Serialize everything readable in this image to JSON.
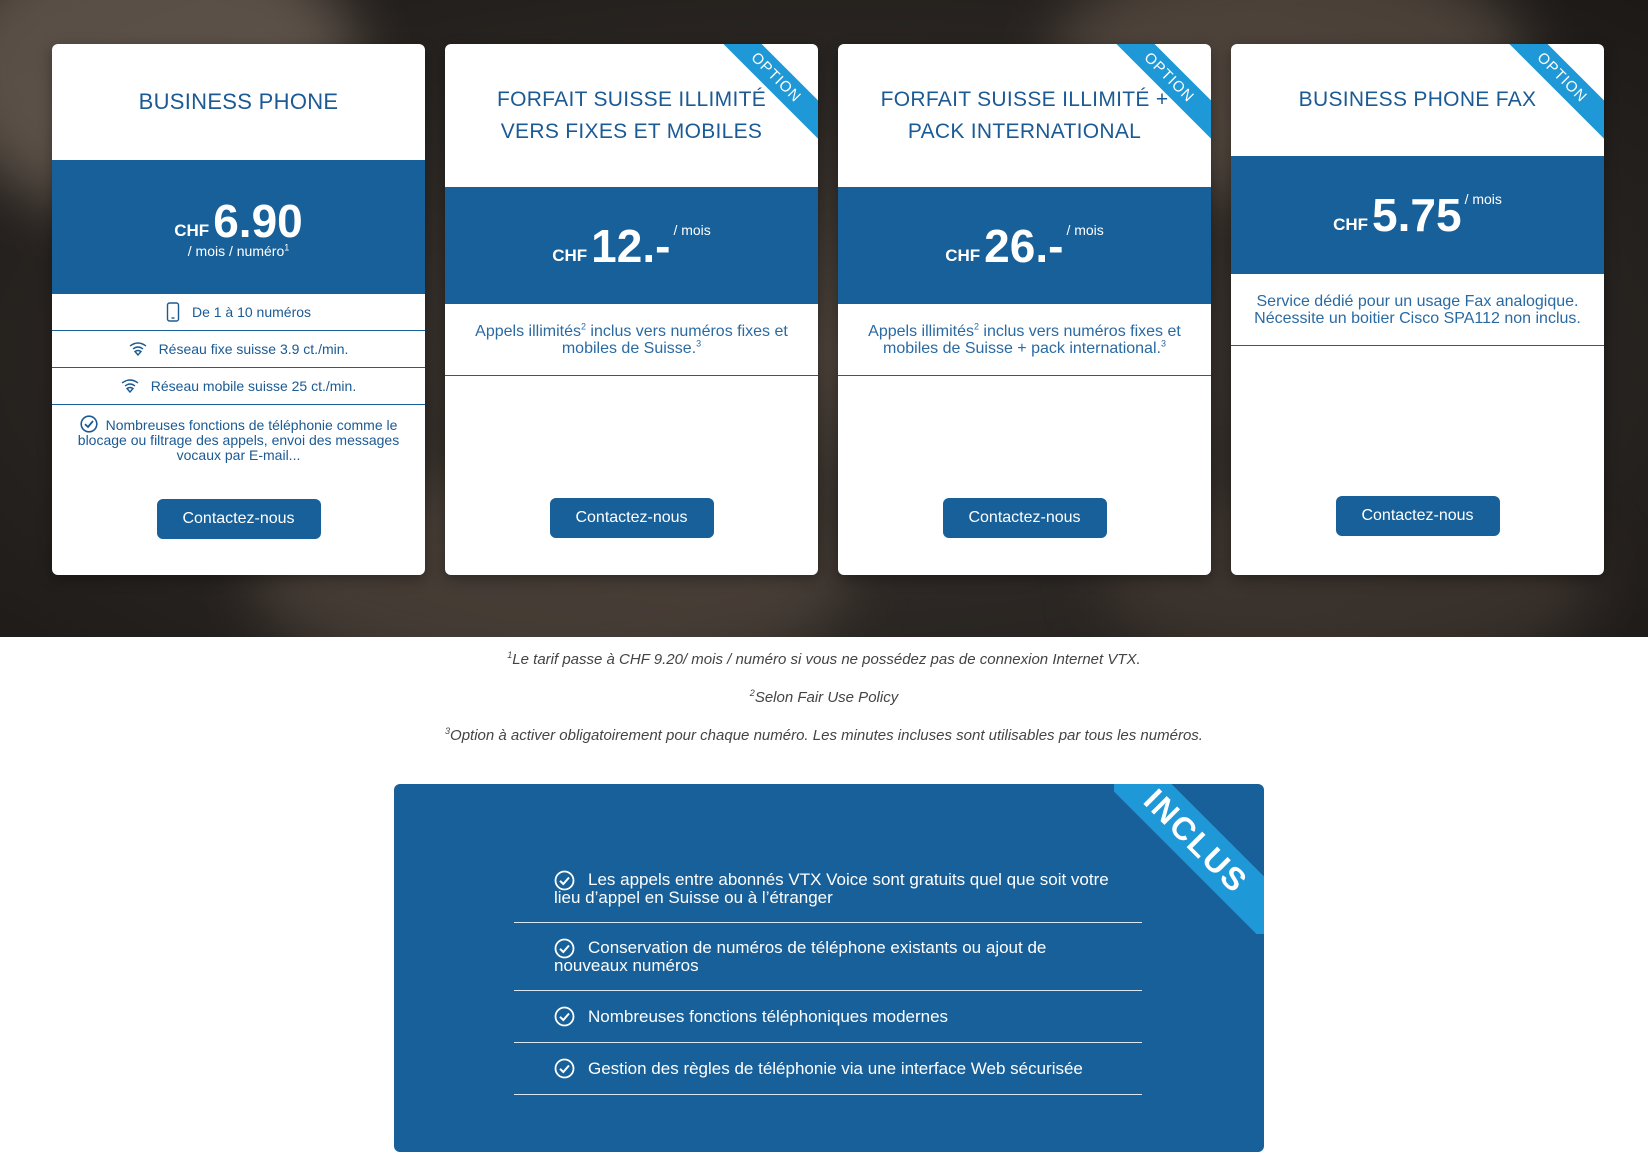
{
  "cards": [
    {
      "title": "BUSINESS PHONE",
      "currency": "CHF",
      "amount": "6.90",
      "unit": "",
      "sub": "/ mois / numéro",
      "sub_sup": "1",
      "features": [
        {
          "icon": "mobile-icon",
          "text": "De 1 à 10 numéros"
        },
        {
          "icon": "wifi-icon",
          "text": "Réseau fixe suisse 3.9 ct./min."
        },
        {
          "icon": "wifi-icon",
          "text": "Réseau mobile suisse 25 ct./min."
        }
      ],
      "multi_feature": "Nombreuses fonctions de téléphonie comme le blocage ou filtrage des appels, envoi des messages vocaux par E-mail...",
      "button": "Contactez-nous"
    },
    {
      "title_line1": "FORFAIT SUISSE ILLIMITÉ",
      "title_line2": "VERS FIXES ET MOBILES",
      "ribbon": "OPTION",
      "currency": "CHF",
      "amount": "12.-",
      "unit": "/ mois",
      "desc_a": "Appels illimités",
      "desc_sup1": "2",
      "desc_b": " inclus vers numéros fixes et mobiles de Suisse.",
      "desc_sup2": "3",
      "button": "Contactez-nous"
    },
    {
      "title_line1": "FORFAIT SUISSE ILLIMITÉ +",
      "title_line2": "PACK INTERNATIONAL",
      "ribbon": "OPTION",
      "currency": "CHF",
      "amount": "26.-",
      "unit": "/ mois",
      "desc_a": "Appels illimités",
      "desc_sup1": "2",
      "desc_b": " inclus vers numéros fixes et mobiles de Suisse + pack international.",
      "desc_sup2": "3",
      "button": "Contactez-nous"
    },
    {
      "title": "BUSINESS PHONE FAX",
      "ribbon": "OPTION",
      "currency": "CHF",
      "amount": "5.75",
      "unit": "/ mois",
      "desc": "Service dédié pour un usage Fax analogique. Nécessite un boitier Cisco SPA112 non inclus.",
      "button": "Contactez-nous"
    }
  ],
  "footnotes": [
    {
      "sup": "1",
      "text": "Le tarif passe à CHF 9.20/ mois / numéro si vous ne possédez pas de connexion Internet VTX."
    },
    {
      "sup": "2",
      "text": "Selon Fair Use Policy"
    },
    {
      "sup": "3",
      "text": "Option à activer obligatoirement pour chaque numéro. Les minutes incluses sont utilisables par tous les numéros."
    }
  ],
  "inclus": {
    "ribbon": "INCLUS",
    "items": [
      {
        "line1": "Les appels entre abonnés VTX Voice sont gratuits quel que soit votre",
        "line2": "lieu d’appel en Suisse ou à l’étranger"
      },
      {
        "line1": "Conservation de numéros de téléphone existants ou ajout de",
        "line2": "nouveaux numéros"
      },
      {
        "line1": "Nombreuses fonctions téléphoniques modernes",
        "line2": ""
      },
      {
        "line1": "Gestion des règles de téléphonie via une interface Web sécurisée",
        "line2": ""
      }
    ]
  },
  "colors": {
    "primary": "#17609a",
    "ribbon": "#1e98d6",
    "title": "#1b5a94"
  }
}
